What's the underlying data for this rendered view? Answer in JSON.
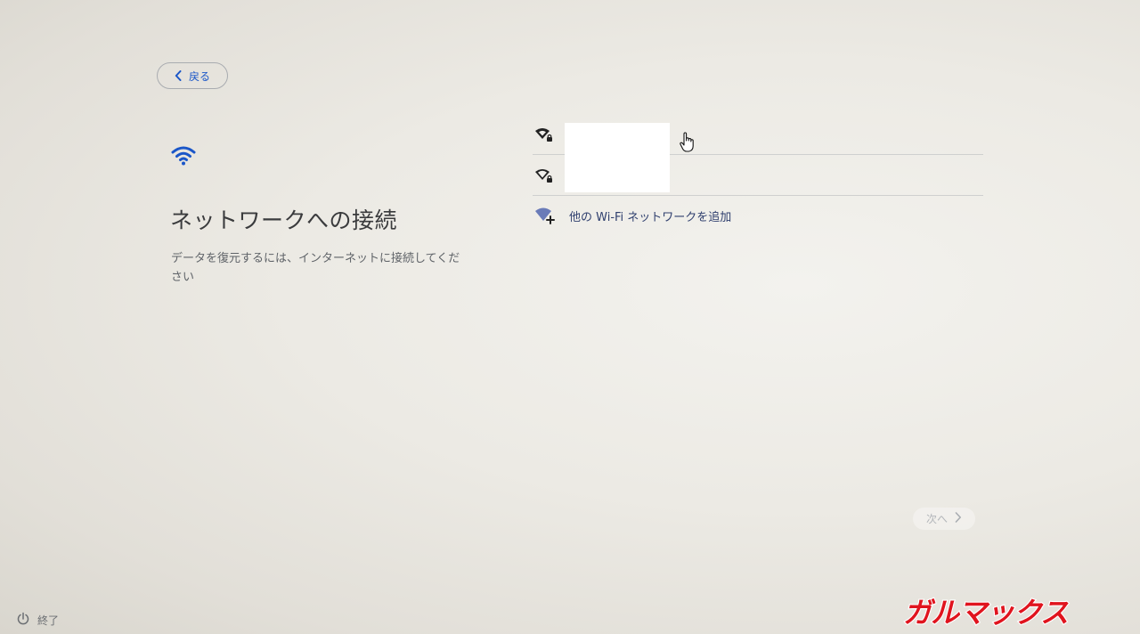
{
  "header": {
    "back_label": "戻る"
  },
  "main": {
    "title": "ネットワークへの接続",
    "subtitle": "データを復元するには、インターネットに接続してください"
  },
  "networks": {
    "add_other_label": "他の Wi-Fi ネットワークを追加"
  },
  "footer": {
    "next_label": "次へ",
    "shutdown_label": "終了"
  },
  "watermark": {
    "text": "ガルマックス"
  },
  "colors": {
    "accent": "#1a56c8",
    "watermark": "#e0141e"
  }
}
